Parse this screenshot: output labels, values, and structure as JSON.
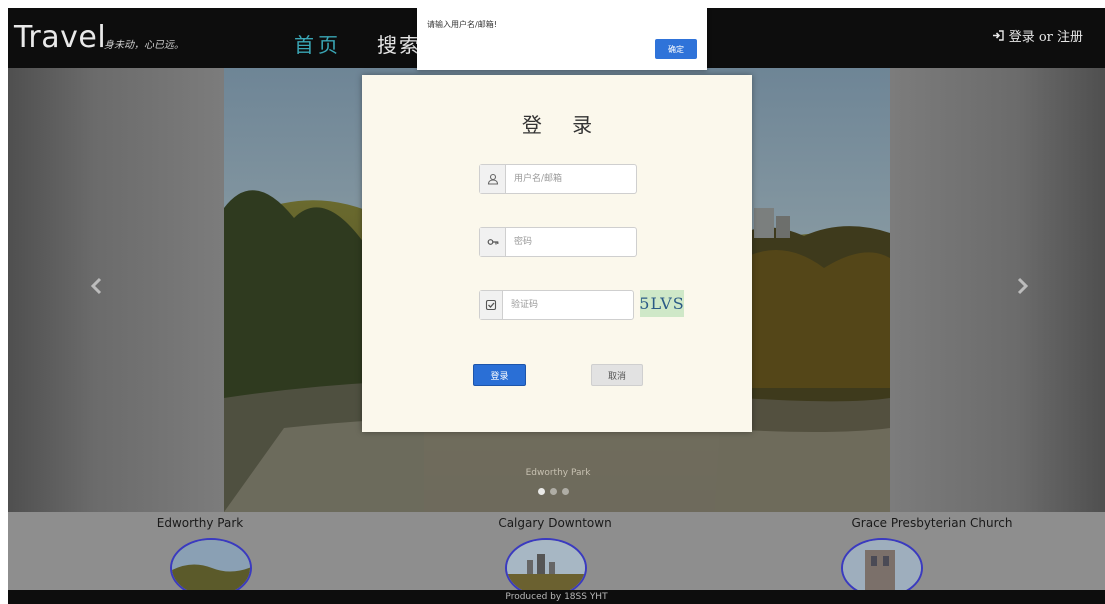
{
  "navbar": {
    "brand": "Travel",
    "slogan": "身未动，心已远。",
    "items": [
      {
        "label": "首页"
      },
      {
        "label": "搜索"
      }
    ],
    "auth_label": "登录 or 注册",
    "home_color": "#3aa6b5"
  },
  "carousel": {
    "caption": "Edworthy Park",
    "dots": 3,
    "active_dot": 0
  },
  "attractions": [
    {
      "title": "Edworthy Park"
    },
    {
      "title": "Calgary Downtown"
    },
    {
      "title": "Grace Presbyterian Church"
    }
  ],
  "footer": {
    "text": "Produced by 18SS YHT"
  },
  "login_modal": {
    "title": "登 录",
    "username_placeholder": "用户名/邮箱",
    "password_placeholder": "密码",
    "captcha_placeholder": "验证码",
    "captcha_text": "5LVS",
    "login_label": "登录",
    "cancel_label": "取消",
    "accent": "#2a6fd6"
  },
  "alert": {
    "message": "请输入用户名/邮箱!",
    "confirm_label": "确定"
  }
}
